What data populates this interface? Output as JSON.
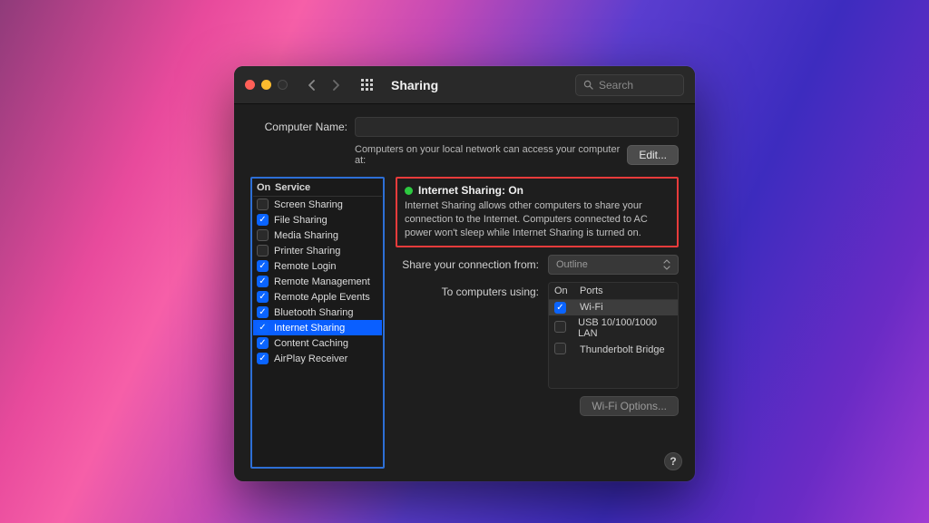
{
  "window": {
    "title": "Sharing",
    "search_placeholder": "Search"
  },
  "computer_name": {
    "label": "Computer Name:",
    "value": "",
    "subtext": "Computers on your local network can access your computer at:",
    "edit_label": "Edit..."
  },
  "services": {
    "header_on": "On",
    "header_service": "Service",
    "items": [
      {
        "label": "Screen Sharing",
        "checked": false
      },
      {
        "label": "File Sharing",
        "checked": true
      },
      {
        "label": "Media Sharing",
        "checked": false
      },
      {
        "label": "Printer Sharing",
        "checked": false
      },
      {
        "label": "Remote Login",
        "checked": true
      },
      {
        "label": "Remote Management",
        "checked": true
      },
      {
        "label": "Remote Apple Events",
        "checked": true
      },
      {
        "label": "Bluetooth Sharing",
        "checked": true
      },
      {
        "label": "Internet Sharing",
        "checked": true,
        "selected": true
      },
      {
        "label": "Content Caching",
        "checked": true
      },
      {
        "label": "AirPlay Receiver",
        "checked": true
      }
    ]
  },
  "detail": {
    "status_title": "Internet Sharing: On",
    "status_desc": "Internet Sharing allows other computers to share your connection to the Internet. Computers connected to AC power won't sleep while Internet Sharing is turned on.",
    "share_from_label": "Share your connection from:",
    "share_from_value": "Outline",
    "to_using_label": "To computers using:",
    "ports_header_on": "On",
    "ports_header_ports": "Ports",
    "ports": [
      {
        "label": "Wi-Fi",
        "checked": true,
        "selected": true
      },
      {
        "label": "USB 10/100/1000 LAN",
        "checked": false
      },
      {
        "label": "Thunderbolt Bridge",
        "checked": false
      }
    ],
    "wifi_options_label": "Wi-Fi Options..."
  },
  "help_label": "?"
}
